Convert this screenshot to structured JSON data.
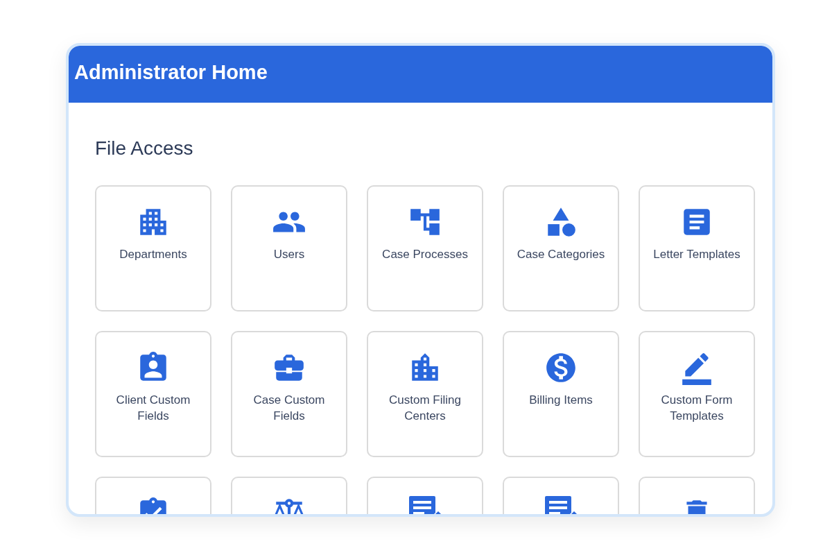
{
  "header": {
    "title": "Administrator Home"
  },
  "section": {
    "title": "File Access"
  },
  "tiles": [
    {
      "label": "Departments"
    },
    {
      "label": "Users"
    },
    {
      "label": "Case Processes"
    },
    {
      "label": "Case Categories"
    },
    {
      "label": "Letter Templates"
    },
    {
      "label": "Client Custom Fields"
    },
    {
      "label": "Case Custom Fields"
    },
    {
      "label": "Custom Filing Centers"
    },
    {
      "label": "Billing Items"
    },
    {
      "label": "Custom Form Templates"
    }
  ]
}
